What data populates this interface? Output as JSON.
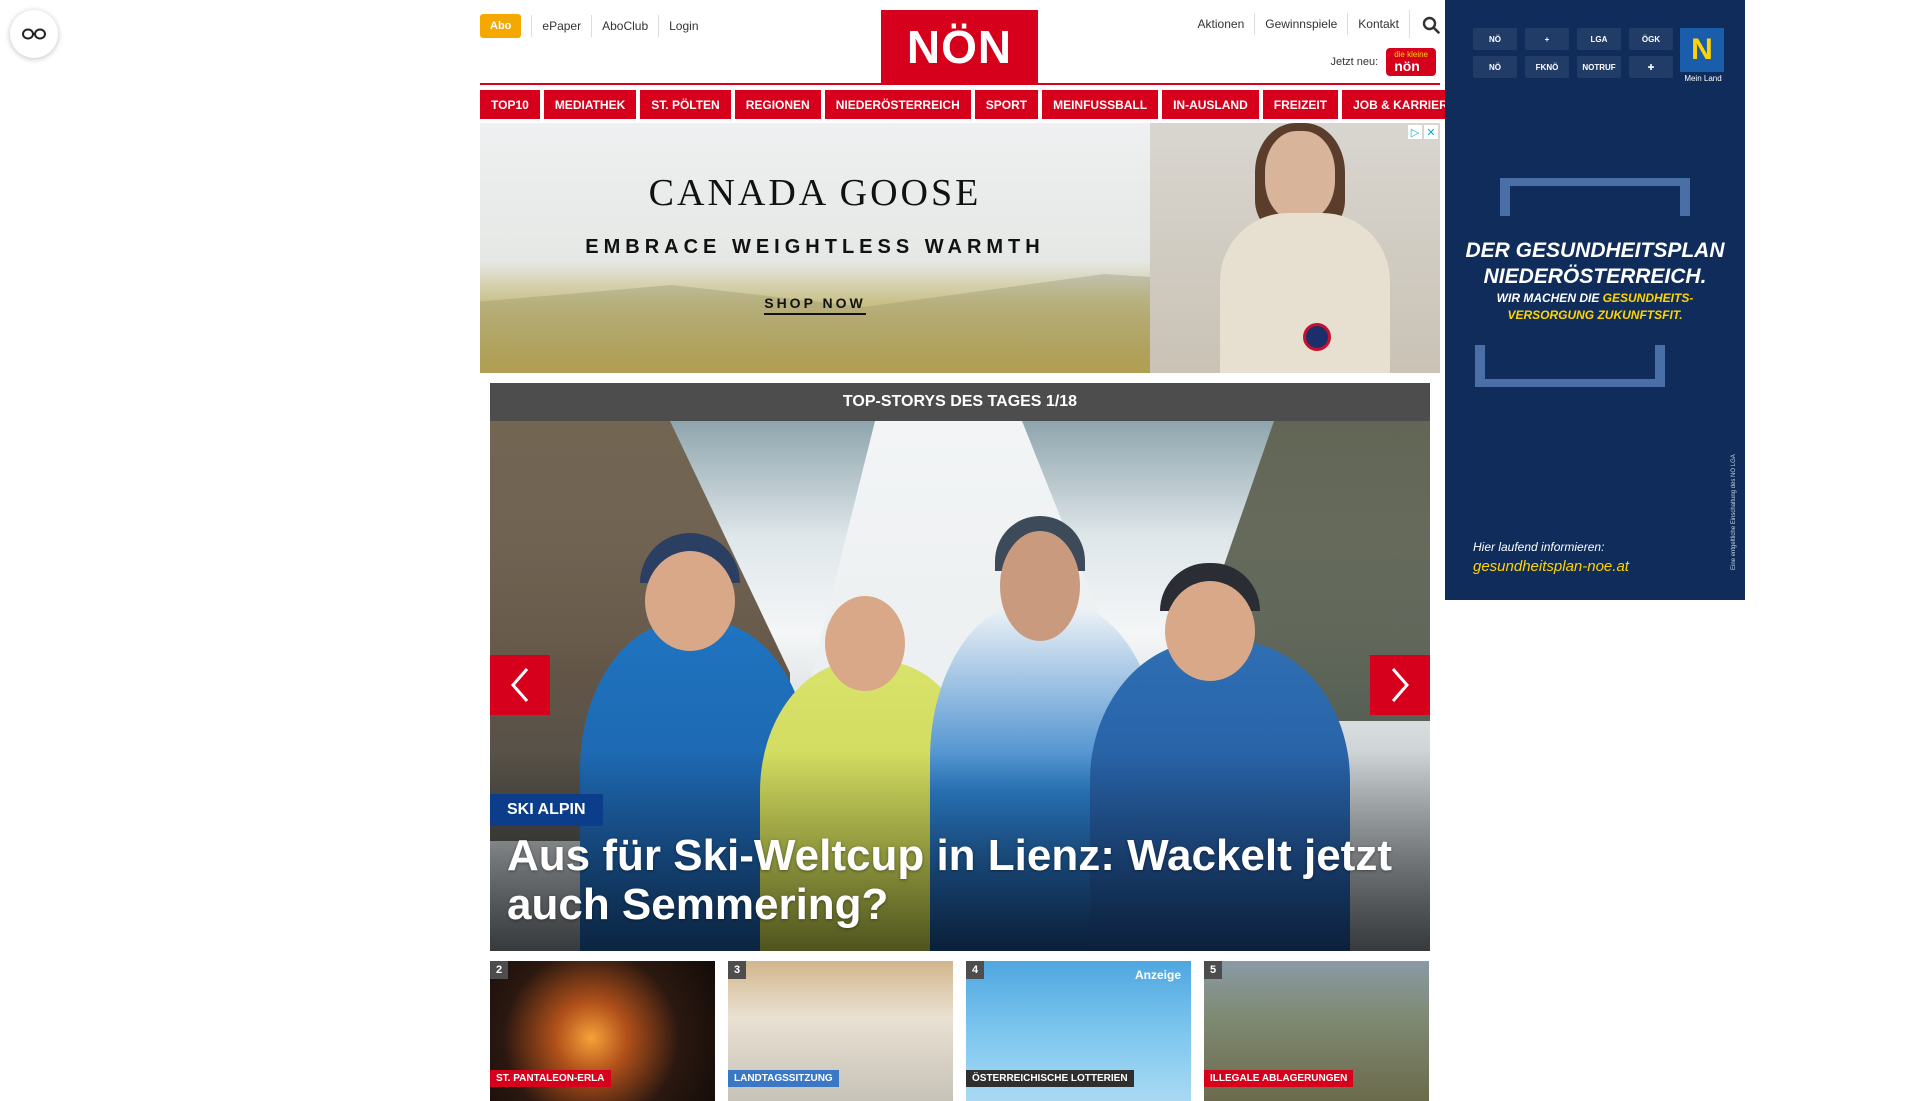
{
  "header": {
    "abo_label": "Abo",
    "left_links": [
      "ePaper",
      "AboClub",
      "Login"
    ],
    "logo_text": "NÖN",
    "right_links": [
      "Aktionen",
      "Gewinnspiele",
      "Kontakt"
    ],
    "jetzt_neu_label": "Jetzt neu:",
    "mini_logo_top": "die kleine",
    "mini_logo_text": "nön",
    "accent_color": "#d6001c",
    "abo_color": "#f5a800"
  },
  "nav": {
    "items": [
      "TOP10",
      "MEDIATHEK",
      "ST. PÖLTEN",
      "REGIONEN",
      "NIEDERÖSTERREICH",
      "SPORT",
      "MEINFUSSBALL",
      "IN-AUSLAND",
      "FREIZEIT",
      "JOB & KARRIERE"
    ]
  },
  "top_ad": {
    "brand": "CANADA GOOSE",
    "tagline": "EMBRACE WEIGHTLESS WARMTH",
    "cta": "SHOP NOW",
    "choices_icons": [
      "adchoices-icon",
      "close-icon"
    ]
  },
  "stories": {
    "header": "TOP-STORYS DES TAGES 1/18",
    "hero": {
      "category": "SKI ALPIN",
      "title": "Aus für Ski-Weltcup in Lienz: Wackelt jetzt auch Semmering?",
      "category_color": "#0b3d8a"
    },
    "thumbs": [
      {
        "num": "2",
        "label": "ST. PANTALEON-ERLA",
        "anzeige": ""
      },
      {
        "num": "3",
        "label": "LANDTAGSSITZUNG",
        "anzeige": ""
      },
      {
        "num": "4",
        "label": "ÖSTERREICHISCHE LOTTERIEN",
        "anzeige": "Anzeige"
      },
      {
        "num": "5",
        "label": "ILLEGALE ABLAGERUNGEN",
        "anzeige": ""
      }
    ]
  },
  "side_ad": {
    "logos": [
      "NÖ",
      "+",
      "LGA",
      "ÖGK",
      "NÖ",
      "FKNÖ",
      "NOTRUF",
      "✚"
    ],
    "mein_land_logo": "N",
    "mein_land_caption": "Mein Land",
    "headline_line1": "DER GESUNDHEITSPLAN",
    "headline_line2": "NIEDERÖSTERREICH.",
    "sub_line1_a": "WIR MACHEN DIE ",
    "sub_line1_b": "GESUNDHEITS-",
    "sub_line2": "VERSORGUNG ZUKUNFTSFIT.",
    "info": "Hier laufend informieren:",
    "url": "gesundheitsplan-noe.at",
    "vertical_text": "Eine entgeltliche Einschaltung des NÖ LGA",
    "bg_color": "#0f2c5b",
    "highlight_color": "#ffd400"
  },
  "reader_toggle_icon": "glasses-icon"
}
